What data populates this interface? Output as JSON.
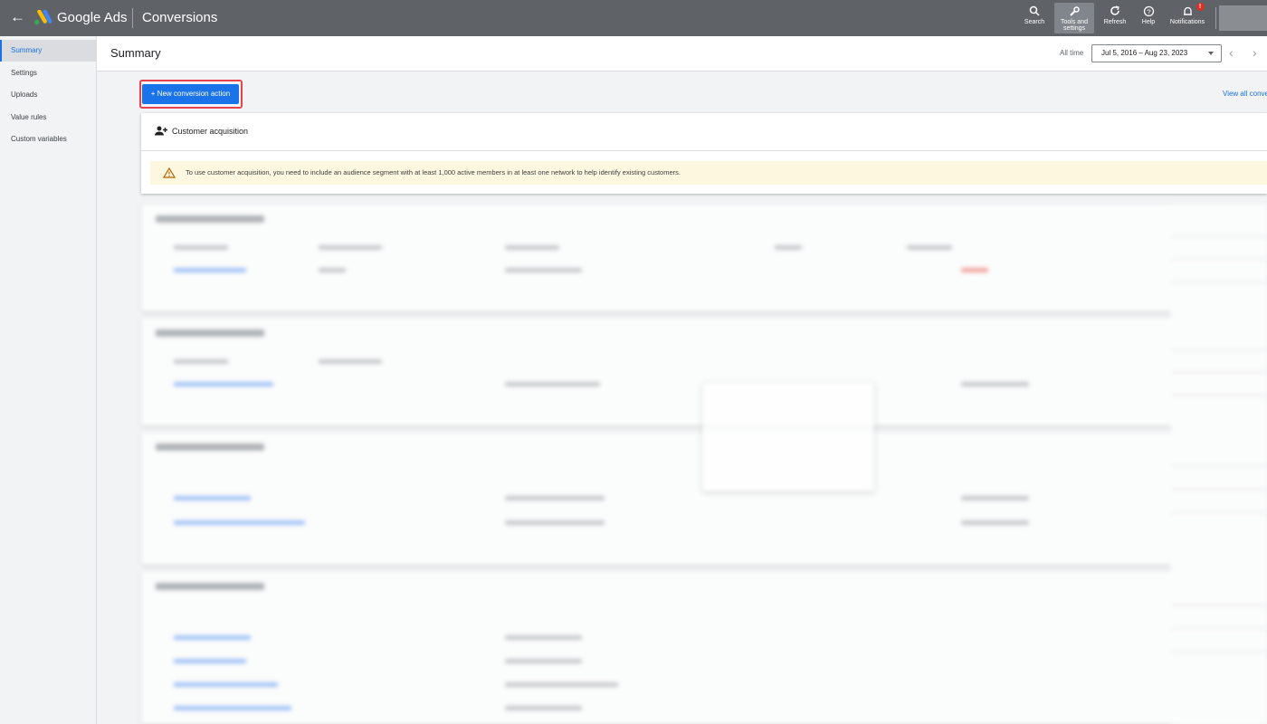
{
  "topbar": {
    "back_icon": "arrow-back-icon",
    "brand": "Google Ads",
    "title": "Conversions",
    "tools": [
      {
        "label": "Search",
        "icon": "search-icon"
      },
      {
        "label": "Tools and\nsettings",
        "icon": "wrench-icon"
      },
      {
        "label": "Refresh",
        "icon": "refresh-icon"
      },
      {
        "label": "Help",
        "icon": "help-icon"
      },
      {
        "label": "Notifications",
        "icon": "bell-icon",
        "badge": "!"
      }
    ]
  },
  "sidebar": {
    "items": [
      {
        "label": "Summary",
        "active": true
      },
      {
        "label": "Settings"
      },
      {
        "label": "Uploads"
      },
      {
        "label": "Value rules"
      },
      {
        "label": "Custom variables"
      }
    ]
  },
  "header": {
    "title": "Summary",
    "range_label": "All time",
    "date_range": "Jul 5, 2016 – Aug 23, 2023"
  },
  "actions": {
    "new_conversion": "+ New conversion action",
    "view_all": "View all conve"
  },
  "customer_acquisition": {
    "icon": "person-add-icon",
    "title": "Customer acquisition",
    "warning_icon": "warning-icon",
    "warning": "To use customer acquisition, you need to include an audience segment with at least 1,000 active members in at least one network to help identify existing customers."
  },
  "colors": {
    "topbar": "#5f6368",
    "accent": "#1a73e8",
    "highlight_border": "#e8424b",
    "warning_bg": "#fef7e0"
  }
}
